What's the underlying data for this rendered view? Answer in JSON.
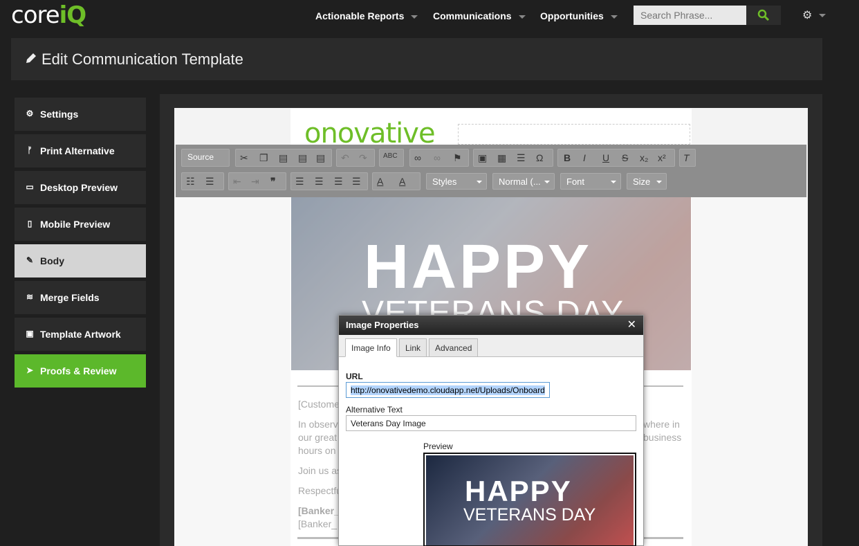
{
  "app": {
    "logo_part1": "core",
    "logo_part2": "iQ"
  },
  "nav": {
    "items": [
      {
        "label": "Actionable Reports"
      },
      {
        "label": "Communications"
      },
      {
        "label": "Opportunities"
      }
    ],
    "search_placeholder": "Search Phrase...",
    "accent": "#6ebe28"
  },
  "header": {
    "title": "Edit Communication Template"
  },
  "sidebar": {
    "items": [
      {
        "label": "Settings",
        "icon": "gear-icon"
      },
      {
        "label": "Print Alternative",
        "icon": "branch-icon"
      },
      {
        "label": "Desktop Preview",
        "icon": "monitor-icon"
      },
      {
        "label": "Mobile Preview",
        "icon": "mobile-icon"
      },
      {
        "label": "Body",
        "icon": "edit-icon",
        "state": "selected"
      },
      {
        "label": "Merge Fields",
        "icon": "database-icon"
      },
      {
        "label": "Template Artwork",
        "icon": "image-icon"
      },
      {
        "label": "Proofs & Review",
        "icon": "send-icon",
        "state": "highlighted"
      }
    ]
  },
  "editor": {
    "source_label": "Source",
    "styles_label": "Styles",
    "format_label": "Normal (...",
    "font_label": "Font",
    "size_label": "Size",
    "email_logo": "onovative",
    "banner_line1": "HAPPY",
    "banner_line2": "VETERANS DAY",
    "body_lines": [
      "[Custome",
      "In observ",
      "our great",
      "hours on",
      "Join us as",
      "Respectfu",
      "[Banker_",
      "[Banker_"
    ],
    "body_right": [
      "where in",
      "business"
    ]
  },
  "dialog": {
    "title": "Image Properties",
    "tabs": [
      "Image Info",
      "Link",
      "Advanced"
    ],
    "url_label": "URL",
    "url_value": "http://onovativedemo.cloudapp.net/Uploads/Onboard",
    "alt_label": "Alternative Text",
    "alt_value": "Veterans Day Image",
    "preview_label": "Preview",
    "preview_line1": "HAPPY",
    "preview_line2": "VETERANS DAY"
  }
}
